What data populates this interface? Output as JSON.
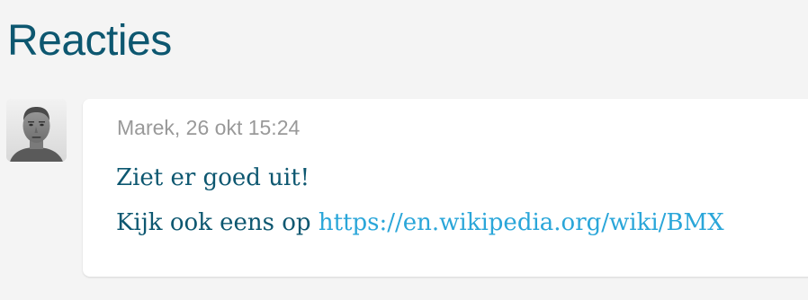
{
  "section": {
    "title": "Reacties"
  },
  "comment": {
    "avatar_icon": "person-photo-icon",
    "meta": "Marek, 26 okt 15:24",
    "line1": "Ziet er goed uit!",
    "line2_prefix": "Kijk ook eens op",
    "link_text": "https://en.wikipedia.org/wiki/BMX"
  },
  "colors": {
    "background": "#f4f4f4",
    "title": "#0d5770",
    "text": "#0d5770",
    "meta": "#999999",
    "link": "#2aa6d9",
    "bubble": "#ffffff"
  }
}
